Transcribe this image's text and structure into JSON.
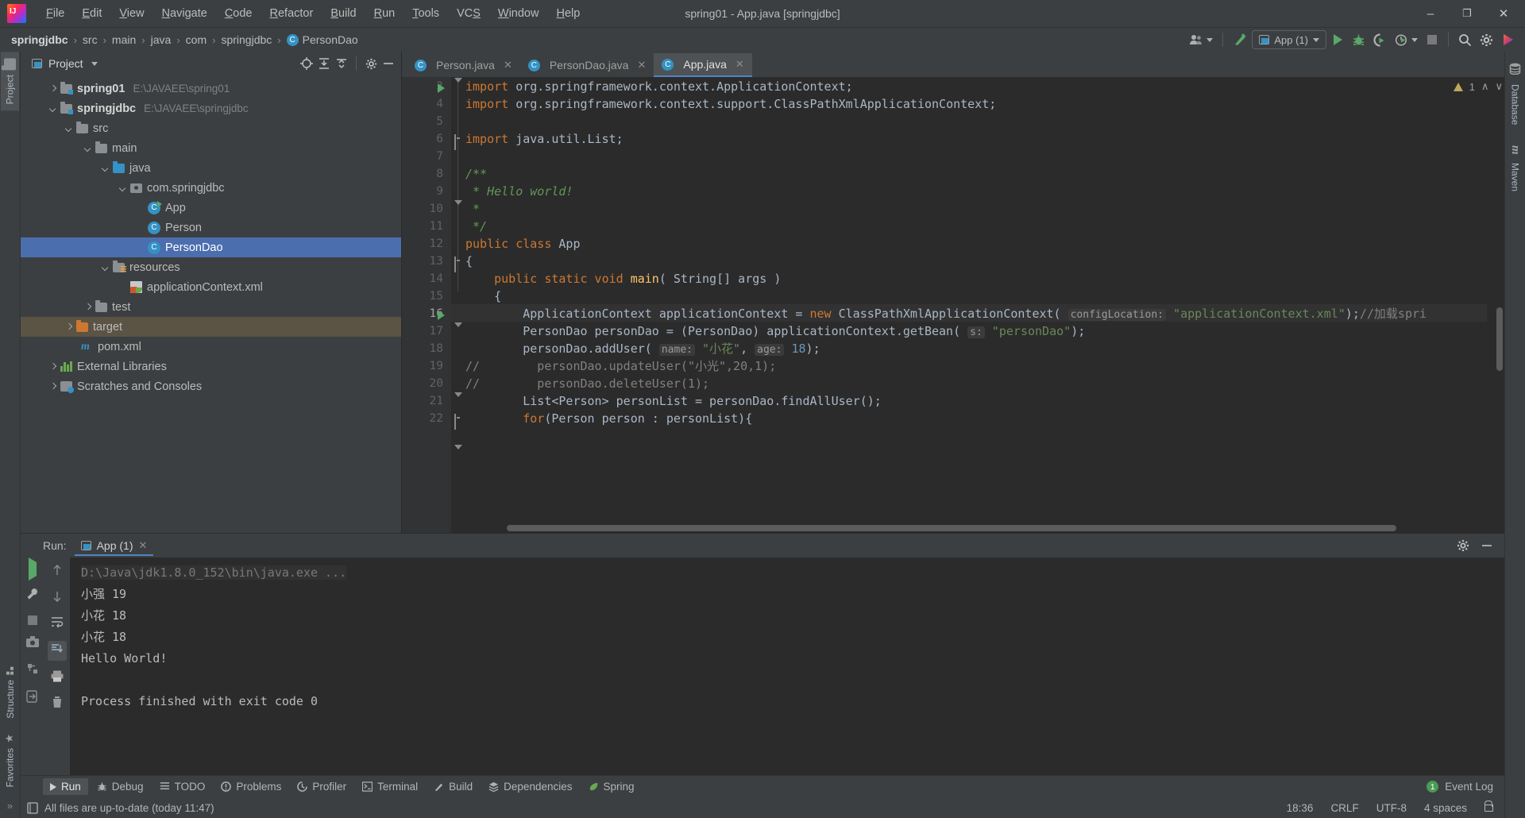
{
  "window": {
    "title": "spring01 - App.java [springjdbc]",
    "minimize_label": "–",
    "maximize_label": "❐",
    "close_label": "✕"
  },
  "menu": [
    {
      "label": "File",
      "accel": "F"
    },
    {
      "label": "Edit",
      "accel": "E"
    },
    {
      "label": "View",
      "accel": "V"
    },
    {
      "label": "Navigate",
      "accel": "N"
    },
    {
      "label": "Code",
      "accel": "C"
    },
    {
      "label": "Refactor",
      "accel": "R"
    },
    {
      "label": "Build",
      "accel": "B"
    },
    {
      "label": "Run",
      "accel": "R"
    },
    {
      "label": "Tools",
      "accel": "T"
    },
    {
      "label": "VCS",
      "accel": "S"
    },
    {
      "label": "Window",
      "accel": "W"
    },
    {
      "label": "Help",
      "accel": "H"
    }
  ],
  "breadcrumb": {
    "items": [
      "springjdbc",
      "src",
      "main",
      "java",
      "com",
      "springjdbc"
    ],
    "separator": "›",
    "current_class": "PersonDao",
    "class_icon": "C"
  },
  "toolbar": {
    "user_icon": "user-icon",
    "build_icon": "hammer-icon",
    "run_config": "App (1)",
    "run_label": "run-button",
    "debug_label": "debug-button",
    "coverage_label": "run-with-coverage-button",
    "profile_label": "profiler-button",
    "stop_label": "stop-button",
    "search_icon": "⌕",
    "settings_icon": "⚙"
  },
  "left_stripe": {
    "tabs": [
      {
        "label": "Project",
        "active": true
      },
      {
        "label": "Structure",
        "active": false
      },
      {
        "label": "Favorites",
        "active": false
      }
    ],
    "more": "»"
  },
  "right_stripe": {
    "tabs": [
      {
        "label": "Database"
      },
      {
        "label": "Maven"
      }
    ]
  },
  "project_panel": {
    "title": "Project",
    "icons": [
      "locate-icon",
      "expand-all-icon",
      "collapse-all-icon",
      "gear-icon",
      "hide-icon"
    ],
    "tree": [
      {
        "label": "spring01",
        "path": "E:\\JAVAEE\\spring01",
        "depth": 0,
        "arrow": "right",
        "icon": "module-folder",
        "bold": true
      },
      {
        "label": "springjdbc",
        "path": "E:\\JAVAEE\\springjdbc",
        "depth": 0,
        "arrow": "down",
        "icon": "module-folder",
        "bold": true
      },
      {
        "label": "src",
        "path": "",
        "depth": 1,
        "arrow": "down",
        "icon": "folder"
      },
      {
        "label": "main",
        "path": "",
        "depth": 2,
        "arrow": "down",
        "icon": "folder"
      },
      {
        "label": "java",
        "path": "",
        "depth": 3,
        "arrow": "down",
        "icon": "source-folder"
      },
      {
        "label": "com.springjdbc",
        "path": "",
        "depth": 4,
        "arrow": "down",
        "icon": "package"
      },
      {
        "label": "App",
        "path": "",
        "depth": 5,
        "arrow": "none",
        "icon": "runnable-class"
      },
      {
        "label": "Person",
        "path": "",
        "depth": 5,
        "arrow": "none",
        "icon": "class"
      },
      {
        "label": "PersonDao",
        "path": "",
        "depth": 5,
        "arrow": "none",
        "icon": "class",
        "selected": true
      },
      {
        "label": "resources",
        "path": "",
        "depth": 3,
        "arrow": "down",
        "icon": "resources-folder"
      },
      {
        "label": "applicationContext.xml",
        "path": "",
        "depth": 4,
        "arrow": "none",
        "icon": "spring-xml"
      },
      {
        "label": "test",
        "path": "",
        "depth": 2,
        "arrow": "right",
        "icon": "folder"
      },
      {
        "label": "target",
        "path": "",
        "depth": 1,
        "arrow": "right",
        "icon": "excluded-folder",
        "highlighted": true
      },
      {
        "label": "pom.xml",
        "path": "",
        "depth": 1,
        "arrow": "none",
        "icon": "maven-xml"
      },
      {
        "label": "External Libraries",
        "path": "",
        "depth": 0,
        "arrow": "right",
        "icon": "libraries"
      },
      {
        "label": "Scratches and Consoles",
        "path": "",
        "depth": 0,
        "arrow": "right",
        "icon": "scratches"
      }
    ]
  },
  "editor": {
    "tabs": [
      {
        "label": "Person.java",
        "active": false,
        "close": "✕"
      },
      {
        "label": "PersonDao.java",
        "active": false,
        "close": "✕"
      },
      {
        "label": "App.java",
        "active": true,
        "close": "✕"
      }
    ],
    "inspection": {
      "warning_count": "1",
      "up": "∧",
      "down": "∨"
    },
    "lines": [
      {
        "n": "3",
        "text": "import org.springframework.context.ApplicationContext;"
      },
      {
        "n": "4",
        "text": "import org.springframework.context.support.ClassPathXmlApplicationContext;"
      },
      {
        "n": "5",
        "text": ""
      },
      {
        "n": "6",
        "text": "import java.util.List;"
      },
      {
        "n": "7",
        "text": ""
      },
      {
        "n": "8",
        "text": "/**"
      },
      {
        "n": "9",
        "text": " * Hello world!"
      },
      {
        "n": "10",
        "text": " *"
      },
      {
        "n": "11",
        "text": " */"
      },
      {
        "n": "12",
        "text": "public class App"
      },
      {
        "n": "13",
        "text": "{"
      },
      {
        "n": "14",
        "text": "    public static void main( String[] args )"
      },
      {
        "n": "15",
        "text": "    {"
      },
      {
        "n": "16",
        "text": "        ApplicationContext applicationContext = new ClassPathXmlApplicationContext( configLocation: \"applicationContext.xml\");//加载spri"
      },
      {
        "n": "17",
        "text": "        PersonDao personDao = (PersonDao) applicationContext.getBean( s: \"personDao\");"
      },
      {
        "n": "18",
        "text": "        personDao.addUser( name: \"小花\", age: 18);"
      },
      {
        "n": "19",
        "text": "//        personDao.updateUser(\"小光\",20,1);"
      },
      {
        "n": "20",
        "text": "//        personDao.deleteUser(1);"
      },
      {
        "n": "21",
        "text": "        List<Person> personList = personDao.findAllUser();"
      },
      {
        "n": "22",
        "text": "        for(Person person : personList){"
      }
    ],
    "hints": [
      "configLocation:",
      "s:",
      "name:",
      "age:"
    ],
    "current_line": "18"
  },
  "run_panel": {
    "label": "Run:",
    "tab": "App (1)",
    "tab_close": "✕",
    "gear_icon": "gear-icon",
    "hide_icon": "hide-icon",
    "console": [
      {
        "text": "D:\\Java\\jdk1.8.0_152\\bin\\java.exe ...",
        "dim": true
      },
      {
        "text": "小强  19",
        "dim": false
      },
      {
        "text": "小花  18",
        "dim": false
      },
      {
        "text": "小花  18",
        "dim": false
      },
      {
        "text": "Hello World!",
        "dim": false
      },
      {
        "text": "",
        "dim": false
      },
      {
        "text": "Process finished with exit code 0",
        "dim": false
      }
    ],
    "tools": [
      "rerun-button",
      "settings-wrench-button",
      "stop-button",
      "camera-button",
      "thread-dump-button",
      "exit-button"
    ],
    "tools2": [
      "up-arrow-button",
      "down-arrow-button",
      "soft-wrap-button",
      "scroll-to-end-button",
      "print-button",
      "clear-all-button"
    ]
  },
  "bottom_tabs": [
    {
      "label": "Run",
      "icon": "play-icon",
      "active": true
    },
    {
      "label": "Debug",
      "icon": "bug-icon",
      "active": false
    },
    {
      "label": "TODO",
      "icon": "list-icon",
      "active": false
    },
    {
      "label": "Problems",
      "icon": "exclamation-icon",
      "active": false
    },
    {
      "label": "Profiler",
      "icon": "profiler-icon",
      "active": false
    },
    {
      "label": "Terminal",
      "icon": "terminal-icon",
      "active": false
    },
    {
      "label": "Build",
      "icon": "hammer-icon",
      "active": false
    },
    {
      "label": "Dependencies",
      "icon": "layers-icon",
      "active": false
    },
    {
      "label": "Spring",
      "icon": "spring-leaf-icon",
      "active": false
    }
  ],
  "event_log": {
    "count": "1",
    "label": "Event Log"
  },
  "status_bar": {
    "message": "All files are up-to-date (today 11:47)",
    "caret": "18:36",
    "line_separator": "CRLF",
    "encoding": "UTF-8",
    "indent": "4 spaces",
    "lock": "unlocked-icon"
  },
  "colors": {
    "accent": "#4f84c4",
    "selection": "#4b6eaf",
    "keyword": "#cc7832",
    "string": "#6a8759",
    "comment": "#808080",
    "javadoc": "#629755",
    "number": "#6897bb",
    "method": "#ffc66d",
    "run_green": "#59a869",
    "warning": "#bba85c",
    "editor_bg": "#2b2b2b",
    "panel_bg": "#3c3f41"
  }
}
